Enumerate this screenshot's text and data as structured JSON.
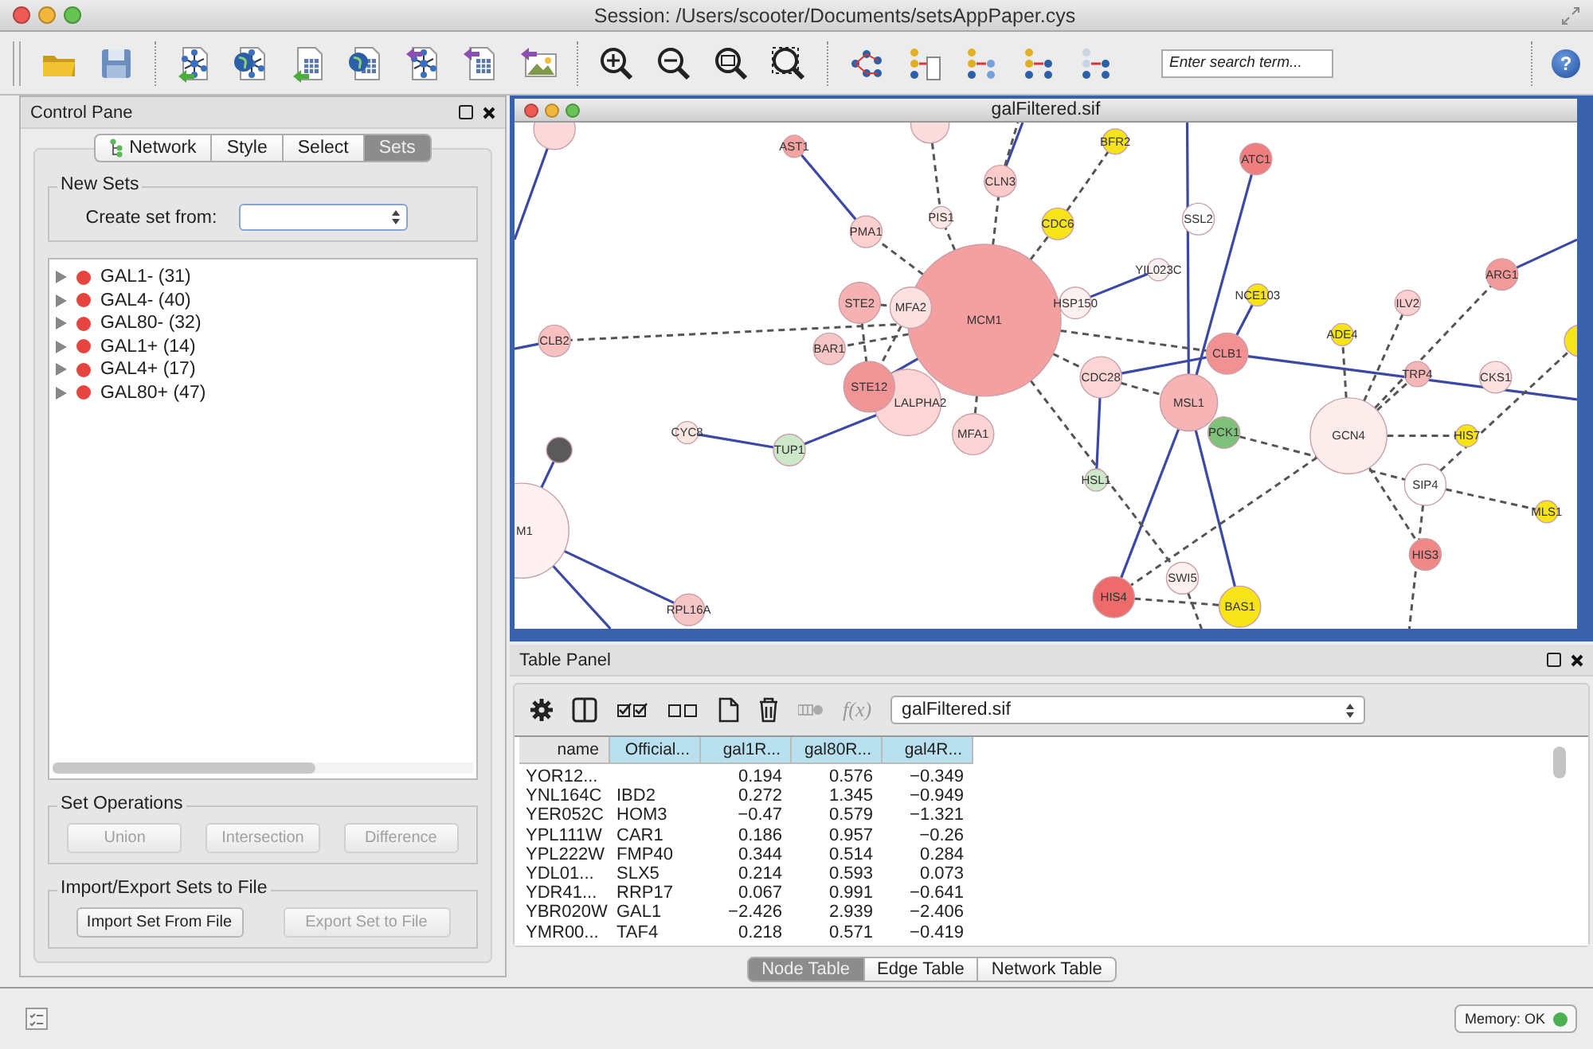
{
  "window": {
    "title": "Session: /Users/scooter/Documents/setsAppPaper.cys"
  },
  "search": {
    "placeholder": "Enter search term..."
  },
  "help": "?",
  "control_pane": {
    "title": "Control Pane",
    "tabs": [
      {
        "label": "Network",
        "selected": false
      },
      {
        "label": "Style",
        "selected": false
      },
      {
        "label": "Select",
        "selected": false
      },
      {
        "label": "Sets",
        "selected": true
      }
    ],
    "new_sets": {
      "title": "New Sets",
      "create_label": "Create set from:"
    },
    "sets": [
      {
        "label": "GAL1- (31)",
        "color": "#e5443f",
        "expanded": false
      },
      {
        "label": "GAL4- (40)",
        "color": "#e5443f",
        "expanded": false
      },
      {
        "label": "GAL80- (32)",
        "color": "#e5443f",
        "expanded": false
      },
      {
        "label": "GAL1+ (14)",
        "color": "#e5443f",
        "expanded": false
      },
      {
        "label": "GAL4+ (17)",
        "color": "#e5443f",
        "expanded": false
      },
      {
        "label": "GAL80+ (47)",
        "color": "#e5443f",
        "expanded": false
      }
    ],
    "set_operations": {
      "title": "Set Operations",
      "buttons": [
        {
          "label": "Union",
          "disabled": true
        },
        {
          "label": "Intersection",
          "disabled": true
        },
        {
          "label": "Difference",
          "disabled": true
        }
      ]
    },
    "import_export": {
      "title": "Import/Export Sets to File",
      "buttons": [
        {
          "label": "Import Set From File",
          "disabled": false
        },
        {
          "label": "Export Set to File",
          "disabled": true
        }
      ]
    }
  },
  "network_view": {
    "title": "galFiltered.sif",
    "nodes": [
      {
        "color": "#fcd9d9"
      },
      {
        "color": "#fcdcdc"
      },
      {
        "label": "AST1",
        "color": "#f4a3a3"
      },
      {
        "label": "BFR2",
        "color": "#f7e418"
      },
      {
        "label": "ATC1",
        "color": "#ef7f7f"
      },
      {
        "label": "CLN3",
        "color": "#fccaca"
      },
      {
        "label": "PIS1",
        "color": "#fde6e6"
      },
      {
        "label": "CDC6",
        "color": "#f7e418"
      },
      {
        "label": "SSL2",
        "color": "#ffffff"
      },
      {
        "label": "PMA1",
        "color": "#fbd0d0"
      },
      {
        "label": "YIL023C",
        "color": "#f7f0f0"
      },
      {
        "label": "ARG1",
        "color": "#f29a9a"
      },
      {
        "label": "NCE103",
        "color": "#f7e418"
      },
      {
        "label": "STE2",
        "color": "#f6b2b2"
      },
      {
        "label": "MFA2",
        "color": "#fde0e0"
      },
      {
        "label": "MCM1",
        "color": "#f4a0a0"
      },
      {
        "label": "HSP150",
        "color": "#fdf0f0"
      },
      {
        "label": "ILV2",
        "color": "#fcd0d0"
      },
      {
        "label": "CLB2",
        "color": "#f9c0c0"
      },
      {
        "label": "ADE4",
        "color": "#f7e418"
      },
      {
        "color": "#f7e418"
      },
      {
        "label": "BAR1",
        "color": "#f6c6c6"
      },
      {
        "label": "CLB1",
        "color": "#f29191"
      },
      {
        "label": "STE12",
        "color": "#ef9595"
      },
      {
        "label": "CDC28",
        "color": "#fcd6d6"
      },
      {
        "label": "TRP4",
        "color": "#f4b6b6"
      },
      {
        "label": "CKS1",
        "color": "#fde0e0"
      },
      {
        "label": "LALPHA2",
        "color": "#fcd6d6"
      },
      {
        "label": "MSL1",
        "color": "#f6b4b4"
      },
      {
        "label": "CYC8",
        "color": "#fde7e2"
      },
      {
        "label": "MFA1",
        "color": "#fbd5d5"
      },
      {
        "label": "PCK1",
        "color": "#7fc07a"
      },
      {
        "label": "GCN4",
        "color": "#fdecec"
      },
      {
        "label": "HIS7",
        "color": "#f7e418"
      },
      {
        "color": "#5a5a5a"
      },
      {
        "label": "TUP1",
        "color": "#cde8c8"
      },
      {
        "label": "HSL1",
        "color": "#cde8c8"
      },
      {
        "label": "SIP4",
        "color": "#ffffff"
      },
      {
        "label": "MLS1",
        "color": "#f7e418"
      },
      {
        "label": "M1",
        "color": "#fff0f2"
      },
      {
        "label": "HIS3",
        "color": "#f08888"
      },
      {
        "label": "SWI5",
        "color": "#fdf0f0"
      },
      {
        "label": "HIS4",
        "color": "#ee6b6b"
      },
      {
        "label": "BAS1",
        "color": "#f7e418"
      },
      {
        "label": "RPL16A",
        "color": "#f6c6c6"
      }
    ],
    "edges": [
      {
        "kind": "solid"
      },
      {
        "kind": "solid"
      },
      {
        "kind": "solid"
      },
      {
        "kind": "solid"
      },
      {
        "kind": "solid"
      },
      {
        "kind": "solid"
      },
      {
        "kind": "solid"
      },
      {
        "kind": "solid"
      },
      {
        "kind": "solid"
      },
      {
        "kind": "solid"
      },
      {
        "kind": "solid"
      },
      {
        "kind": "solid"
      },
      {
        "kind": "solid"
      },
      {
        "kind": "solid"
      },
      {
        "kind": "solid"
      },
      {
        "kind": "solid"
      },
      {
        "kind": "solid"
      },
      {
        "kind": "solid"
      },
      {
        "kind": "solid"
      },
      {
        "kind": "solid"
      },
      {
        "kind": "dashed"
      },
      {
        "kind": "dashed"
      },
      {
        "kind": "dashed"
      },
      {
        "kind": "dashed"
      },
      {
        "kind": "dashed"
      },
      {
        "kind": "dashed"
      },
      {
        "kind": "dashed"
      },
      {
        "kind": "dashed"
      },
      {
        "kind": "dashed"
      },
      {
        "kind": "dashed"
      },
      {
        "kind": "dashed"
      },
      {
        "kind": "dashed"
      },
      {
        "kind": "dashed"
      },
      {
        "kind": "dashed"
      },
      {
        "kind": "dashed"
      },
      {
        "kind": "dashed"
      },
      {
        "kind": "dashed"
      },
      {
        "kind": "dashed"
      },
      {
        "kind": "dashed"
      },
      {
        "kind": "dashed"
      },
      {
        "kind": "dashed"
      },
      {
        "kind": "dashed"
      },
      {
        "kind": "dashed"
      },
      {
        "kind": "dashed"
      },
      {
        "kind": "dashed"
      },
      {
        "kind": "dashed"
      },
      {
        "kind": "dashed"
      },
      {
        "kind": "dashed"
      },
      {
        "kind": "dashed"
      },
      {
        "kind": "dashed"
      }
    ]
  },
  "table_panel": {
    "title": "Table Panel",
    "function_label": "f(x)",
    "table_select": "galFiltered.sif",
    "columns": [
      {
        "label": "name",
        "selected": false
      },
      {
        "label": "Official...",
        "selected": true
      },
      {
        "label": "gal1R...",
        "selected": true
      },
      {
        "label": "gal80R...",
        "selected": true
      },
      {
        "label": "gal4R...",
        "selected": true
      }
    ],
    "rows": [
      {
        "name": "YOR12...",
        "gal1r": "0.194",
        "gal80r": "0.576",
        "gal4r": "−0.349"
      },
      {
        "name": "YNL164C",
        "official": "IBD2",
        "gal1r": "0.272",
        "gal80r": "1.345",
        "gal4r": "−0.949"
      },
      {
        "name": "YER052C",
        "official": "HOM3",
        "gal1r": "−0.47",
        "gal80r": "0.579",
        "gal4r": "−1.321"
      },
      {
        "name": "YPL111W",
        "official": "CAR1",
        "gal1r": "0.186",
        "gal80r": "0.957",
        "gal4r": "−0.26"
      },
      {
        "name": "YPL222W",
        "official": "FMP40",
        "gal1r": "0.344",
        "gal80r": "0.514",
        "gal4r": "0.284"
      },
      {
        "name": "YDL01...",
        "official": "SLX5",
        "gal1r": "0.214",
        "gal80r": "0.593",
        "gal4r": "0.073"
      },
      {
        "name": "YDR41...",
        "official": "RRP17",
        "gal1r": "0.067",
        "gal80r": "0.991",
        "gal4r": "−0.641"
      },
      {
        "name": "YBR020W",
        "official": "GAL1",
        "gal1r": "−2.426",
        "gal80r": "2.939",
        "gal4r": "−2.406"
      },
      {
        "name": "YMR00...",
        "official": "TAF4",
        "gal1r": "0.218",
        "gal80r": "0.571",
        "gal4r": "−0.419"
      }
    ],
    "tabs": [
      {
        "label": "Node Table",
        "selected": true
      },
      {
        "label": "Edge Table",
        "selected": false
      },
      {
        "label": "Network Table",
        "selected": false
      }
    ]
  },
  "status_bar": {
    "memory": "Memory: OK",
    "memory_ok": true
  }
}
